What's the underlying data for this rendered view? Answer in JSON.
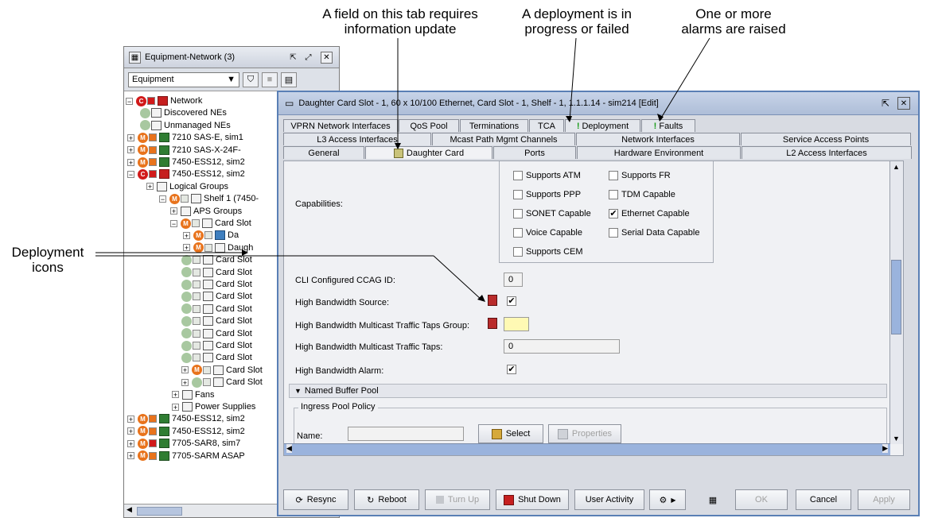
{
  "annotations": {
    "info_update": "A field on this tab requires\ninformation update",
    "deployment": "A deployment is in\nprogress or failed",
    "alarms": "One or more\nalarms are raised",
    "deployment_icons": "Deployment\nicons"
  },
  "tree": {
    "title": "Equipment-Network (3)",
    "combo_value": "Equipment",
    "items": [
      {
        "label": "Network"
      },
      {
        "label": "Discovered NEs"
      },
      {
        "label": "Unmanaged NEs"
      },
      {
        "label": "7210 SAS-E, sim1"
      },
      {
        "label": "7210 SAS-X-24F-"
      },
      {
        "label": "7450-ESS12, sim2"
      },
      {
        "label": "7450-ESS12, sim2"
      },
      {
        "label": "Logical Groups"
      },
      {
        "label": "Shelf 1 (7450-"
      },
      {
        "label": "APS Groups"
      },
      {
        "label": "Card Slot"
      },
      {
        "label": "Da"
      },
      {
        "label": "Daugh"
      },
      {
        "label": "Card Slot"
      },
      {
        "label": "Card Slot"
      },
      {
        "label": "Card Slot"
      },
      {
        "label": "Card Slot"
      },
      {
        "label": "Card Slot"
      },
      {
        "label": "Card Slot"
      },
      {
        "label": "Card Slot"
      },
      {
        "label": "Card Slot"
      },
      {
        "label": "Card Slot"
      },
      {
        "label": "Card Slot"
      },
      {
        "label": "Card Slot"
      },
      {
        "label": "Fans"
      },
      {
        "label": "Power Supplies"
      },
      {
        "label": "7450-ESS12, sim2"
      },
      {
        "label": "7450-ESS12, sim2"
      },
      {
        "label": "7705-SAR8, sim7"
      },
      {
        "label": "7705-SARM ASAP"
      }
    ]
  },
  "dialog": {
    "title": "Daughter Card Slot - 1, 60 x 10/100 Ethernet, Card Slot - 1, Shelf - 1, 1.1.1.14 - sim214 [Edit]",
    "tabs_row1": [
      "VPRN Network Interfaces",
      "QoS Pool",
      "Terminations",
      "TCA",
      "Deployment",
      "Faults"
    ],
    "tabs_row2": [
      "L3 Access Interfaces",
      "Mcast Path Mgmt Channels",
      "Network Interfaces",
      "Service Access Points"
    ],
    "tabs_row3": [
      "General",
      "Daughter Card",
      "Ports",
      "Hardware Environment",
      "L2 Access Interfaces"
    ],
    "capabilities_label": "Capabilities:",
    "capabilities": [
      {
        "label": "Supports ATM",
        "checked": false
      },
      {
        "label": "Supports FR",
        "checked": false
      },
      {
        "label": "Supports PPP",
        "checked": false
      },
      {
        "label": "TDM Capable",
        "checked": false
      },
      {
        "label": "SONET Capable",
        "checked": false
      },
      {
        "label": "Ethernet Capable",
        "checked": true
      },
      {
        "label": "Voice Capable",
        "checked": false
      },
      {
        "label": "Serial Data Capable",
        "checked": false
      },
      {
        "label": "Supports CEM",
        "checked": false
      }
    ],
    "fields": {
      "ccag_label": "CLI Configured CCAG ID:",
      "ccag_value": "0",
      "hb_source_label": "High Bandwidth Source:",
      "hb_mcast_group_label": "High Bandwidth Multicast Traffic Taps Group:",
      "hb_mcast_group_value": "",
      "hb_mcast_taps_label": "High Bandwidth Multicast Traffic Taps:",
      "hb_mcast_taps_value": "0",
      "hb_alarm_label": "High Bandwidth Alarm:"
    },
    "named_buffer_pool": "Named Buffer Pool",
    "ingress_pool_policy": "Ingress Pool Policy",
    "name_label": "Name:",
    "select_label": "Select",
    "properties_label": "Properties",
    "buttons": {
      "resync": "Resync",
      "reboot": "Reboot",
      "turn_up": "Turn Up",
      "shut_down": "Shut Down",
      "user_activity": "User Activity",
      "ok": "OK",
      "cancel": "Cancel",
      "apply": "Apply"
    }
  }
}
